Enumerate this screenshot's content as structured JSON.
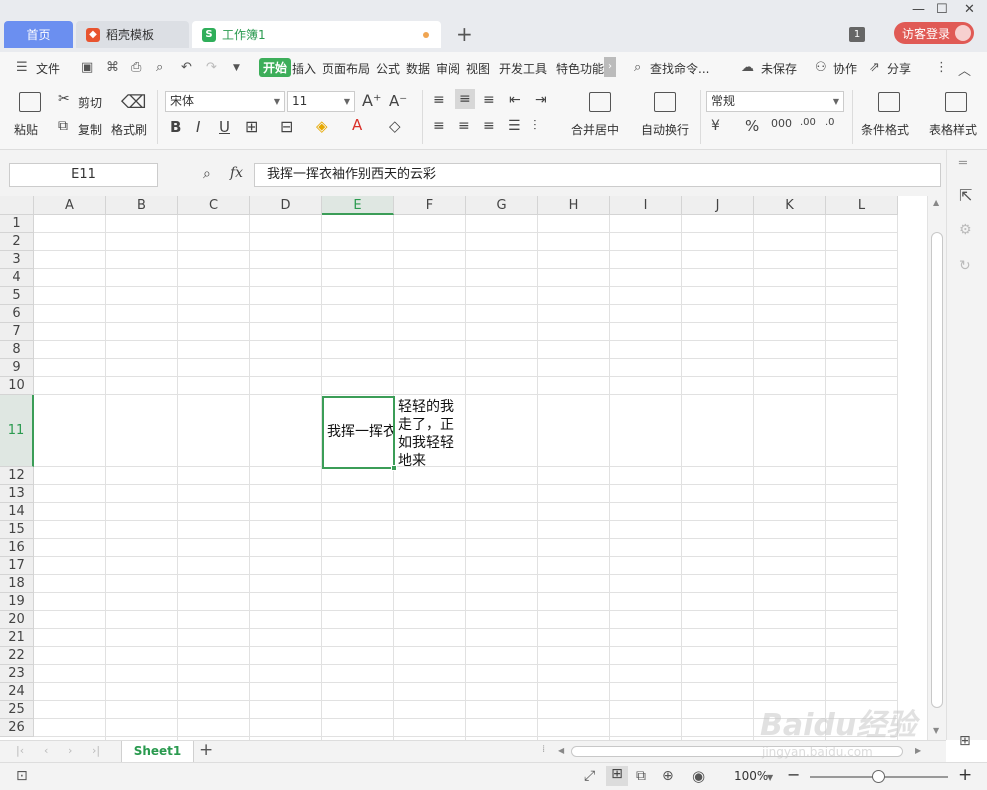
{
  "tabs": {
    "home": "首页",
    "template": "稻壳模板",
    "workbook": "工作簿1",
    "window_count": "1",
    "login": "访客登录"
  },
  "menu": {
    "file": "文件",
    "items": [
      "开始",
      "插入",
      "页面布局",
      "公式",
      "数据",
      "审阅",
      "视图",
      "开发工具",
      "特色功能"
    ],
    "search": "查找命令...",
    "unsaved": "未保存",
    "collab": "协作",
    "share": "分享"
  },
  "ribbon": {
    "paste": "粘贴",
    "cut": "剪切",
    "copy": "复制",
    "format_painter": "格式刷",
    "font_name": "宋体",
    "font_size": "11",
    "merge_center": "合并居中",
    "auto_wrap": "自动换行",
    "number_format": "常规",
    "conditional_format": "条件格式",
    "table_style": "表格样式"
  },
  "formula_bar": {
    "cell_ref": "E11",
    "fx": "fx",
    "content": "我挥一挥衣袖作别西天的云彩"
  },
  "grid": {
    "columns": [
      "A",
      "B",
      "C",
      "D",
      "E",
      "F",
      "G",
      "H",
      "I",
      "J",
      "K",
      "L"
    ],
    "rows": [
      "1",
      "2",
      "3",
      "4",
      "5",
      "6",
      "7",
      "8",
      "9",
      "10",
      "11",
      "12",
      "13",
      "14",
      "15",
      "16",
      "17",
      "18",
      "19",
      "20",
      "21",
      "22",
      "23",
      "24",
      "25",
      "26"
    ],
    "active_column": "E",
    "active_row": "11",
    "cell_e11": "我挥一挥衣袖作别西天的云彩",
    "cell_f11": "轻轻的我走了，正如我轻轻地来"
  },
  "sheets": {
    "active": "Sheet1"
  },
  "status": {
    "zoom": "100%"
  },
  "watermark": {
    "brand": "Baidu经验",
    "url": "jingyan.baidu.com"
  }
}
